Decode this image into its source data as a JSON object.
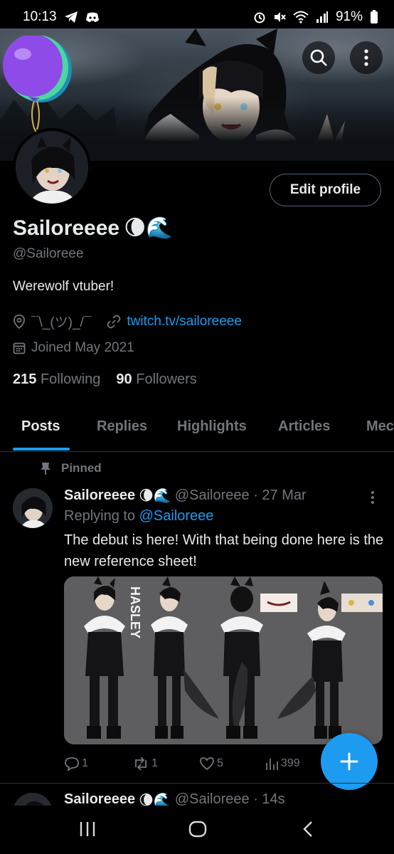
{
  "status_bar": {
    "time": "10:13",
    "battery": "91%"
  },
  "profile": {
    "display_name": "Sailoreeee",
    "name_emojis": "🌘🌊",
    "handle": "@Sailoreee",
    "bio": "Werewolf vtuber!",
    "location": "¯\\_(ツ)_/¯",
    "website": "twitch.tv/sailoreeee",
    "joined": "Joined May 2021",
    "following_count": "215",
    "following_label": "Following",
    "followers_count": "90",
    "followers_label": "Followers",
    "edit_profile_label": "Edit profile"
  },
  "tabs": [
    "Posts",
    "Replies",
    "Highlights",
    "Articles",
    "Mec"
  ],
  "pinned_post": {
    "pinned_label": "Pinned",
    "author": "Sailoreeee",
    "author_emojis": "🌘🌊",
    "handle_date": "@Sailoreee · 27 Mar",
    "replying_prefix": "Replying to",
    "replying_handle": "@Sailoreee",
    "text": "The debut is here! With that being done here is the new reference sheet!",
    "media_label": "HASLEY",
    "replies": "1",
    "reposts": "1",
    "likes": "5",
    "views": "399"
  },
  "next_post": {
    "author": "Sailoreeee",
    "author_emojis": "🌘🌊",
    "handle_date": "@Sailoreee · 14s"
  },
  "colors": {
    "accent": "#1d9bf0",
    "text": "#e7e9ea",
    "muted": "#71767b",
    "border": "#2f3336"
  },
  "icons": [
    "telegram-icon",
    "discord-icon",
    "alarm-icon",
    "mute-icon",
    "wifi-icon",
    "signal-icon",
    "battery-icon",
    "search-icon",
    "more-icon",
    "balloon-icon",
    "location-icon",
    "link-icon",
    "calendar-icon",
    "pin-icon",
    "reply-icon",
    "repost-icon",
    "like-icon",
    "views-icon",
    "compose-icon",
    "recents-icon",
    "home-icon",
    "back-icon"
  ]
}
